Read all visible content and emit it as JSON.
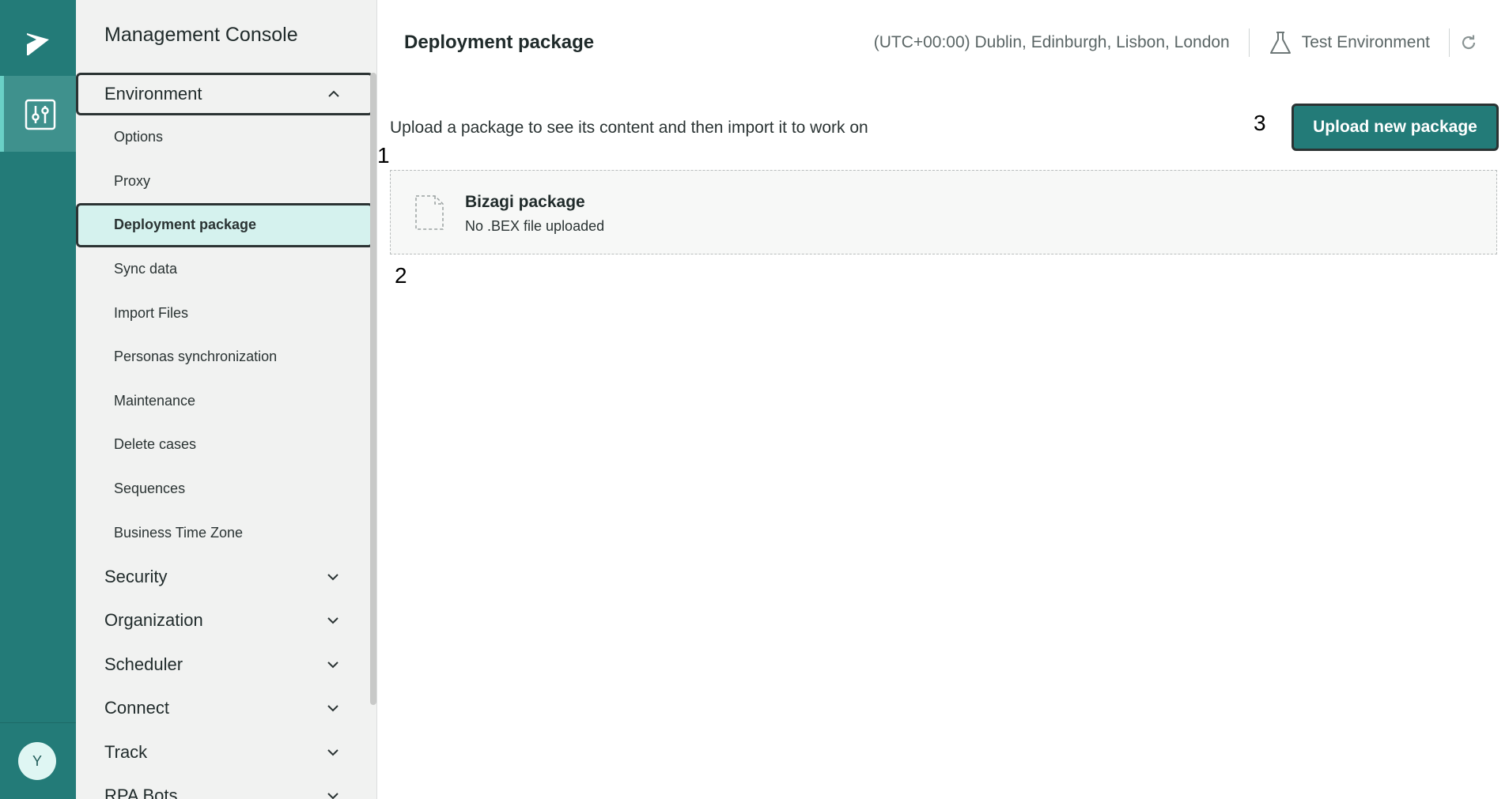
{
  "rail": {
    "avatar_initial": "Y",
    "accent": "#237b78"
  },
  "sidebar": {
    "title": "Management Console",
    "groups": [
      {
        "label": "Environment",
        "expanded": true,
        "items": [
          {
            "label": "Options"
          },
          {
            "label": "Proxy"
          },
          {
            "label": "Deployment package",
            "active": true
          },
          {
            "label": "Sync data"
          },
          {
            "label": "Import Files"
          },
          {
            "label": "Personas synchronization"
          },
          {
            "label": "Maintenance"
          },
          {
            "label": "Delete cases"
          },
          {
            "label": "Sequences"
          },
          {
            "label": "Business Time Zone"
          }
        ]
      },
      {
        "label": "Security",
        "expanded": false
      },
      {
        "label": "Organization",
        "expanded": false
      },
      {
        "label": "Scheduler",
        "expanded": false
      },
      {
        "label": "Connect",
        "expanded": false
      },
      {
        "label": "Track",
        "expanded": false
      },
      {
        "label": "RPA Bots",
        "expanded": false
      }
    ]
  },
  "header": {
    "title": "Deployment package",
    "timezone": "(UTC+00:00) Dublin, Edinburgh, Lisbon, London",
    "environment": "Test Environment"
  },
  "main": {
    "instruction": "Upload a package to see its content and then import it to work on",
    "upload_button": "Upload new package",
    "package": {
      "name": "Bizagi package",
      "status": "No .BEX file uploaded"
    }
  },
  "markers": [
    "1",
    "2",
    "3"
  ]
}
